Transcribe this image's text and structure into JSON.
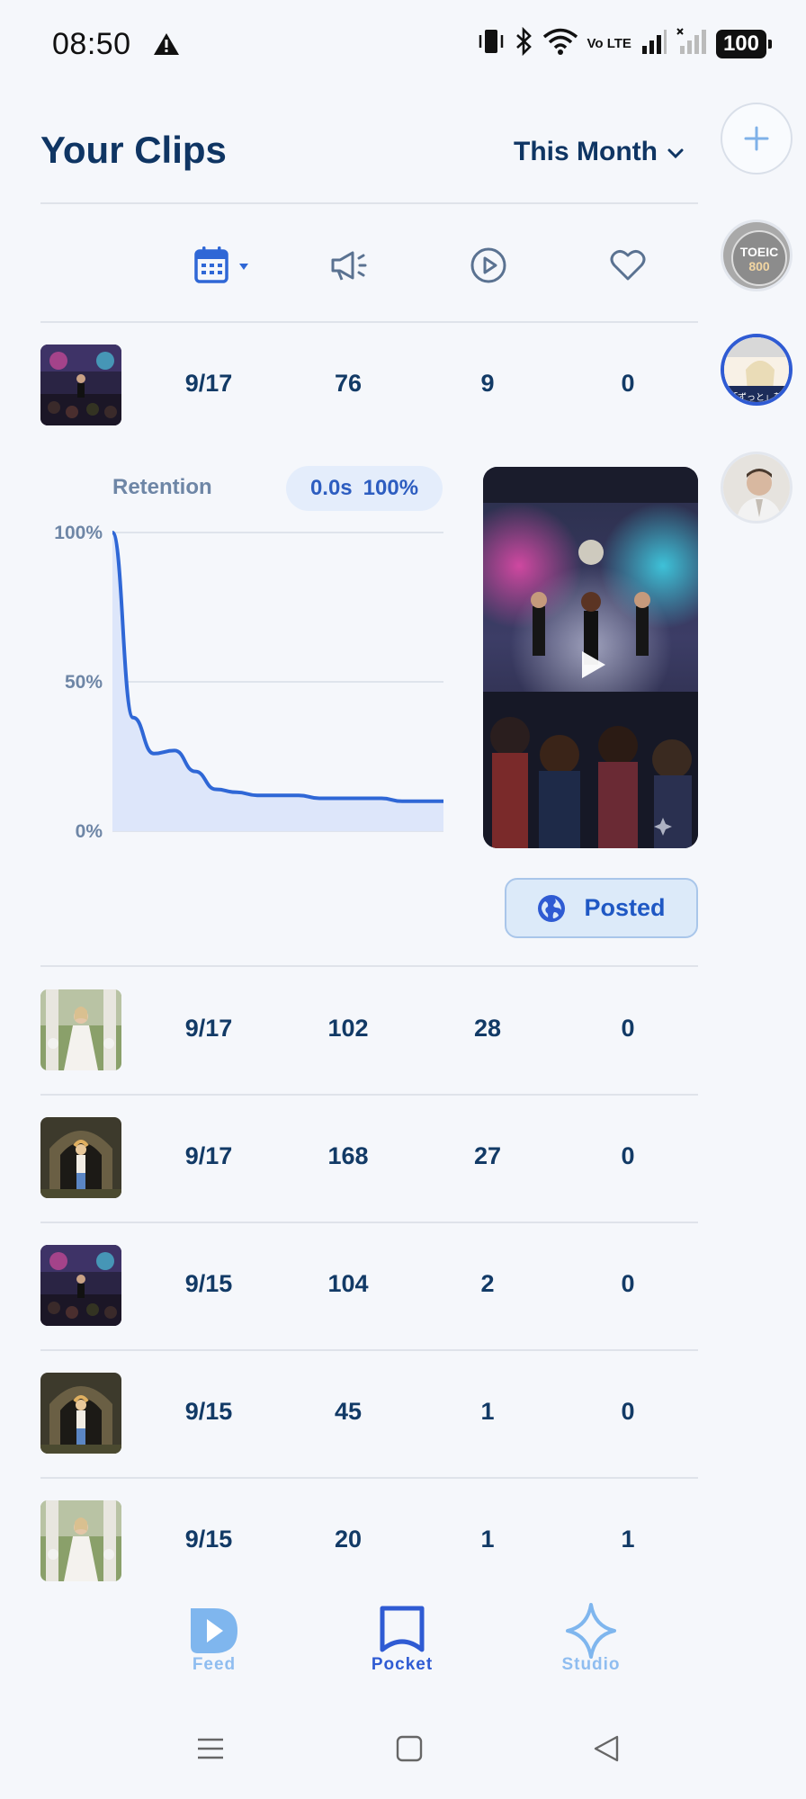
{
  "status": {
    "time": "08:50",
    "battery": "100",
    "network": "Vo LTE"
  },
  "header": {
    "title": "Your Clips",
    "period": "This Month"
  },
  "avatars": [
    {
      "name": "toeic-avatar",
      "text": "TOEIC 800"
    },
    {
      "name": "lesson-avatar",
      "text": "「ずっと」英語"
    },
    {
      "name": "man-avatar",
      "text": ""
    }
  ],
  "columns": [
    {
      "icon": "calendar-icon"
    },
    {
      "icon": "megaphone-icon"
    },
    {
      "icon": "play-icon"
    },
    {
      "icon": "heart-icon"
    }
  ],
  "rows": [
    {
      "thumb": "concert",
      "date": "9/17",
      "views": "76",
      "plays": "9",
      "likes": "0",
      "expanded": true
    },
    {
      "thumb": "bride",
      "date": "9/17",
      "views": "102",
      "plays": "28",
      "likes": "0"
    },
    {
      "thumb": "tunnel",
      "date": "9/17",
      "views": "168",
      "plays": "27",
      "likes": "0"
    },
    {
      "thumb": "concert",
      "date": "9/15",
      "views": "104",
      "plays": "2",
      "likes": "0"
    },
    {
      "thumb": "tunnel",
      "date": "9/15",
      "views": "45",
      "plays": "1",
      "likes": "0"
    },
    {
      "thumb": "bride",
      "date": "9/15",
      "views": "20",
      "plays": "1",
      "likes": "1"
    }
  ],
  "retention": {
    "label": "Retention",
    "time": "0.0s",
    "percent": "100%",
    "yticks": [
      "100%",
      "50%",
      "0%"
    ],
    "points": [
      100,
      38,
      26,
      27,
      20,
      14,
      13,
      12,
      12,
      12,
      11,
      11,
      11,
      11,
      10,
      10,
      10
    ]
  },
  "posted": {
    "label": "Posted"
  },
  "nav": {
    "feed": "Feed",
    "pocket": "Pocket",
    "studio": "Studio"
  },
  "colors": {
    "accent": "#2f5bd3",
    "text": "#123a66",
    "muted": "#6e86a6"
  }
}
